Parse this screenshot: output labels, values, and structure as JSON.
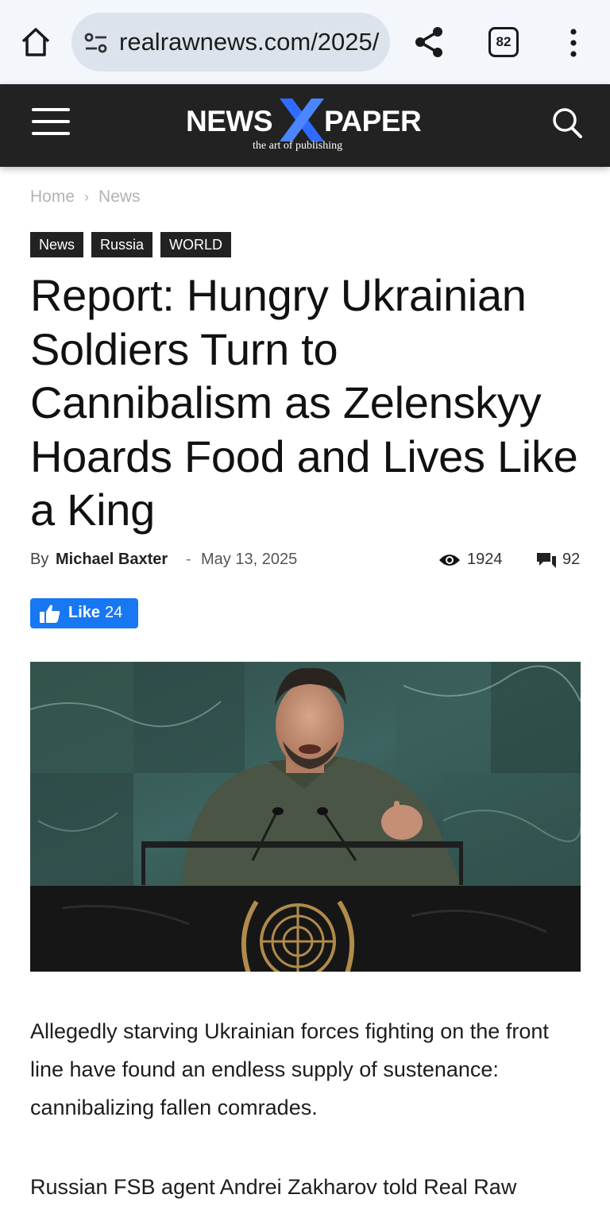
{
  "browser": {
    "url": "realrawnews.com/2025/",
    "tab_count": "82"
  },
  "site": {
    "logo_left": "NEWS",
    "logo_right": "PAPER",
    "tagline": "the art of publishing",
    "logo_accent_color": "#2f6bff"
  },
  "breadcrumb": {
    "home": "Home",
    "separator": "›",
    "current": "News"
  },
  "tags": [
    "News",
    "Russia",
    "WORLD"
  ],
  "article": {
    "title": "Report: Hungry Ukrainian Soldiers Turn to Cannibalism as Zelenskyy Hoards Food and Lives Like a King",
    "by_label": "By",
    "author": "Michael Baxter",
    "dash": "-",
    "date": "May 13, 2025",
    "views": "1924",
    "comments": "92",
    "paragraph_1": "Allegedly starving Ukrainian forces fighting on the front line have found an endless supply of sustenance: cannibalizing fallen comrades.",
    "paragraph_2": "Russian FSB agent Andrei Zakharov told Real Raw"
  },
  "like_button": {
    "label": "Like",
    "count": "24",
    "color": "#1877f2"
  },
  "icons": {
    "home": "home-icon",
    "tune": "site-settings-icon",
    "share": "share-icon",
    "menu": "more-vert-icon",
    "hamburger": "hamburger-menu-icon",
    "search": "search-icon",
    "views": "eye-icon",
    "comments": "comment-icon",
    "like": "thumbs-up-icon"
  }
}
